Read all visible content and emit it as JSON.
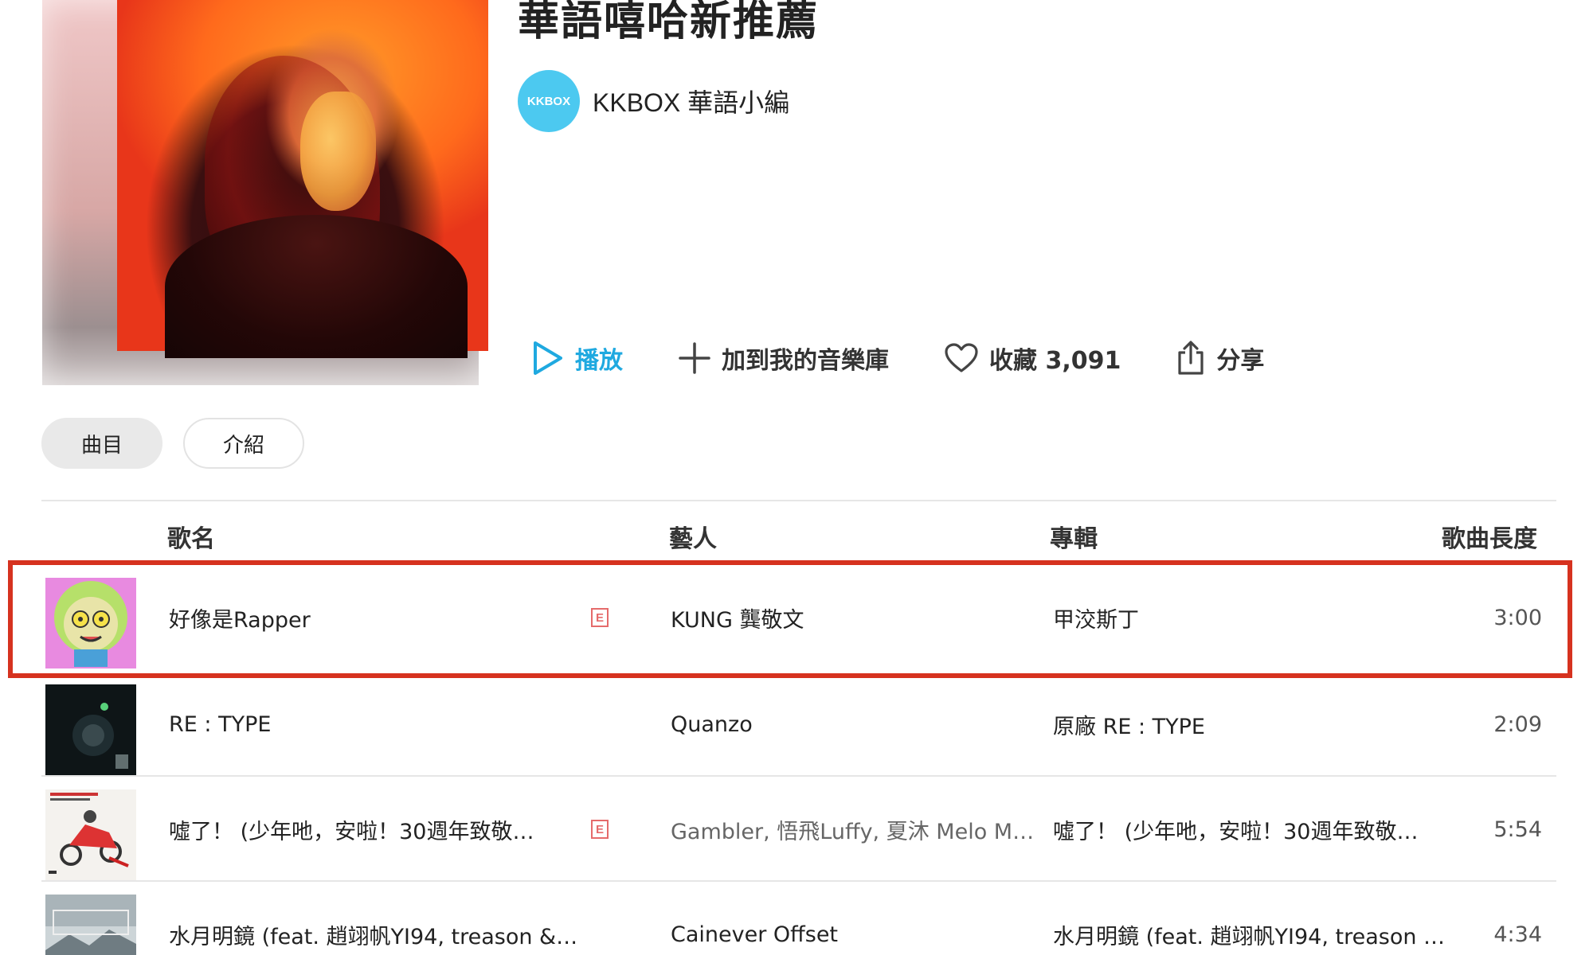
{
  "playlist": {
    "title": "華語嘻哈新推薦",
    "curator_avatar_text": "KKBOX",
    "curator_name": "KKBOX 華語小編"
  },
  "actions": {
    "play": "播放",
    "add_to_library": "加到我的音樂庫",
    "favorite": "收藏 3,091",
    "share": "分享"
  },
  "tabs": {
    "tracks": "曲目",
    "intro": "介紹"
  },
  "table": {
    "headers": {
      "song": "歌名",
      "artist": "藝人",
      "album": "專輯",
      "duration": "歌曲長度"
    },
    "rows": [
      {
        "song": "好像是Rapper",
        "explicit": "E",
        "artist": "KUNG 龔敬文",
        "album": "甲洨斯丁",
        "duration": "3:00"
      },
      {
        "song": "RE : TYPE",
        "explicit": "",
        "artist": "Quanzo",
        "album": "原廠 RE : TYPE",
        "duration": "2:09"
      },
      {
        "song": "噓了！ (少年吔，安啦！30週年致敬…",
        "explicit": "E",
        "artist": "Gambler, 悟飛Luffy, 夏沐 Melo M…",
        "album": "噓了！ (少年吔，安啦！30週年致敬…",
        "duration": "5:54"
      },
      {
        "song": "水月明鏡 (feat. 趙翊帆YI94, treason &…",
        "explicit": "",
        "artist": "Cainever Offset",
        "album": "水月明鏡 (feat. 趙翊帆YI94, treason …",
        "duration": "4:34"
      }
    ]
  },
  "colors": {
    "accent": "#1fa9e0",
    "highlight": "#d6321f",
    "explicit": "#e56b6b",
    "avatar": "#4cc9f0"
  }
}
